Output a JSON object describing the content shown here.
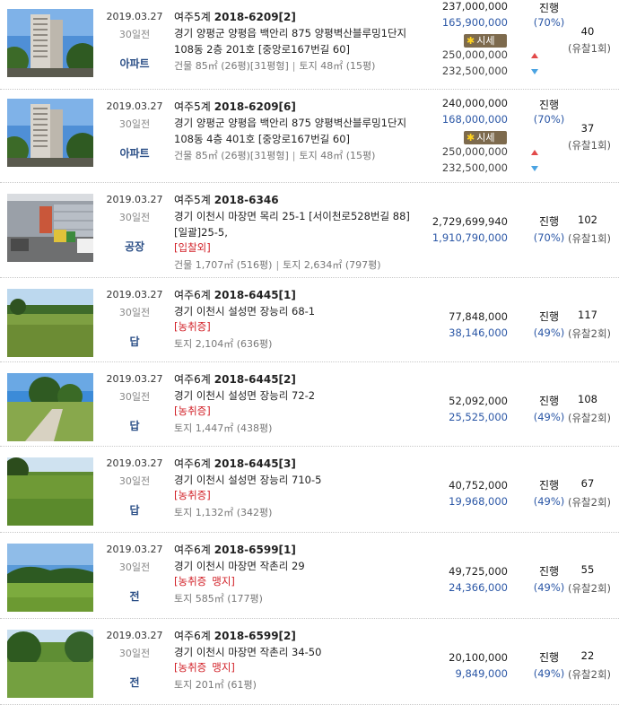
{
  "listings": [
    {
      "date": "2019.03.27",
      "ago": "30일전",
      "type": "아파트",
      "court": "여주5계",
      "case_no": "2018-6209[2]",
      "address": "경기 양평군 양평읍 백안리 875 양평벽산블루밍1단지 108동 2층 201호 [중앙로167번길 60]",
      "tags": [],
      "area": [
        "건물 85㎡ (26평)[31평형]",
        "토지 48㎡ (15평)"
      ],
      "appraisal": "237,000,000",
      "min_price": "165,900,000",
      "market_badge": "시세",
      "market_high": "250,000,000",
      "market_low": "232,500,000",
      "status": "진행",
      "ratio": "(70%)",
      "views": "40",
      "failed": "(유찰1회)",
      "thumb": "apartment"
    },
    {
      "date": "2019.03.27",
      "ago": "30일전",
      "type": "아파트",
      "court": "여주5계",
      "case_no": "2018-6209[6]",
      "address": "경기 양평군 양평읍 백안리 875 양평벽산블루밍1단지 108동 4층 401호 [중앙로167번길 60]",
      "tags": [],
      "area": [
        "건물 85㎡ (26평)[31평형]",
        "토지 48㎡ (15평)"
      ],
      "appraisal": "240,000,000",
      "min_price": "168,000,000",
      "market_badge": "시세",
      "market_high": "250,000,000",
      "market_low": "232,500,000",
      "status": "진행",
      "ratio": "(70%)",
      "views": "37",
      "failed": "(유찰1회)",
      "thumb": "apartment"
    },
    {
      "date": "2019.03.27",
      "ago": "30일전",
      "type": "공장",
      "court": "여주5계",
      "case_no": "2018-6346",
      "address": "경기 이천시 마장면 목리 25-1 [서이천로528번길 88] [일괄]25-5,",
      "tags": [
        "[입찰외]"
      ],
      "area": [
        "건물 1,707㎡ (516평)",
        "토지 2,634㎡ (797평)"
      ],
      "appraisal": "2,729,699,940",
      "min_price": "1,910,790,000",
      "status": "진행",
      "ratio": "(70%)",
      "views": "102",
      "failed": "(유찰1회)",
      "thumb": "factory"
    },
    {
      "date": "2019.03.27",
      "ago": "30일전",
      "type": "답",
      "court": "여주6계",
      "case_no": "2018-6445[1]",
      "address": "경기 이천시 설성면 장능리 68-1",
      "tags": [
        "[농취증]"
      ],
      "area": [
        "토지 2,104㎡ (636평)"
      ],
      "appraisal": "77,848,000",
      "min_price": "38,146,000",
      "status": "진행",
      "ratio": "(49%)",
      "views": "117",
      "failed": "(유찰2회)",
      "thumb": "field1"
    },
    {
      "date": "2019.03.27",
      "ago": "30일전",
      "type": "답",
      "court": "여주6계",
      "case_no": "2018-6445[2]",
      "address": "경기 이천시 설성면 장능리 72-2",
      "tags": [
        "[농취증]"
      ],
      "area": [
        "토지 1,447㎡ (438평)"
      ],
      "appraisal": "52,092,000",
      "min_price": "25,525,000",
      "status": "진행",
      "ratio": "(49%)",
      "views": "108",
      "failed": "(유찰2회)",
      "thumb": "field2"
    },
    {
      "date": "2019.03.27",
      "ago": "30일전",
      "type": "답",
      "court": "여주6계",
      "case_no": "2018-6445[3]",
      "address": "경기 이천시 설성면 장능리 710-5",
      "tags": [
        "[농취증]"
      ],
      "area": [
        "토지 1,132㎡ (342평)"
      ],
      "appraisal": "40,752,000",
      "min_price": "19,968,000",
      "status": "진행",
      "ratio": "(49%)",
      "views": "67",
      "failed": "(유찰2회)",
      "thumb": "field3"
    },
    {
      "date": "2019.03.27",
      "ago": "30일전",
      "type": "전",
      "court": "여주6계",
      "case_no": "2018-6599[1]",
      "address": "경기 이천시 마장면 작촌리 29",
      "tags": [
        "[농취증",
        "맹지]"
      ],
      "area": [
        "토지 585㎡ (177평)"
      ],
      "appraisal": "49,725,000",
      "min_price": "24,366,000",
      "status": "진행",
      "ratio": "(49%)",
      "views": "55",
      "failed": "(유찰2회)",
      "thumb": "field4"
    },
    {
      "date": "2019.03.27",
      "ago": "30일전",
      "type": "전",
      "court": "여주6계",
      "case_no": "2018-6599[2]",
      "address": "경기 이천시 마장면 작촌리 34-50",
      "tags": [
        "[농취증",
        "맹지]"
      ],
      "area": [
        "토지 201㎡ (61평)"
      ],
      "appraisal": "20,100,000",
      "min_price": "9,849,000",
      "status": "진행",
      "ratio": "(49%)",
      "views": "22",
      "failed": "(유찰2회)",
      "thumb": "field5"
    }
  ]
}
